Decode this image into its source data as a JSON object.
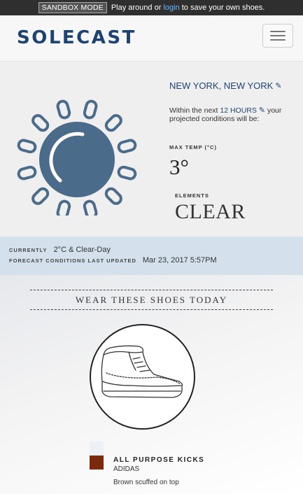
{
  "sandbox": {
    "badge": "SANDBOX MODE",
    "msg_prefix": "Play around or",
    "login_link": "login",
    "msg_suffix": "to save your own shoes."
  },
  "header": {
    "logo": "SOLECAST",
    "menu_icon": "hamburger-menu-icon"
  },
  "weather": {
    "icon": "sun-icon",
    "location": "NEW YORK, NEW YORK",
    "within_prefix": "Within the next",
    "hours": "12 HOURS",
    "within_suffix": "your projected conditions will be:",
    "max_temp_label": "MAX TEMP (°C)",
    "max_temp_value": "3°",
    "elements_label": "ELEMENTS",
    "elements_value": "CLEAR"
  },
  "current": {
    "currently_label": "CURRENTLY",
    "currently_value": "2°C & Clear-Day",
    "updated_label": "FORECAST CONDITIONS LAST UPDATED",
    "updated_value": "Mar 23, 2017 5:57PM"
  },
  "shoes": {
    "heading": "WEAR THESE SHOES TODAY",
    "shoe_icon": "high-top-sneaker-icon",
    "name": "ALL PURPOSE KICKS",
    "brand": "ADIDAS",
    "note": "Brown scuffed on top",
    "colors": [
      "#eef0f8",
      "#7a2a0a"
    ]
  },
  "colors": {
    "brand": "#1d4372",
    "sun": "#4a6b8a",
    "band": "#d4e1ec",
    "link": "#6ab4ff"
  }
}
